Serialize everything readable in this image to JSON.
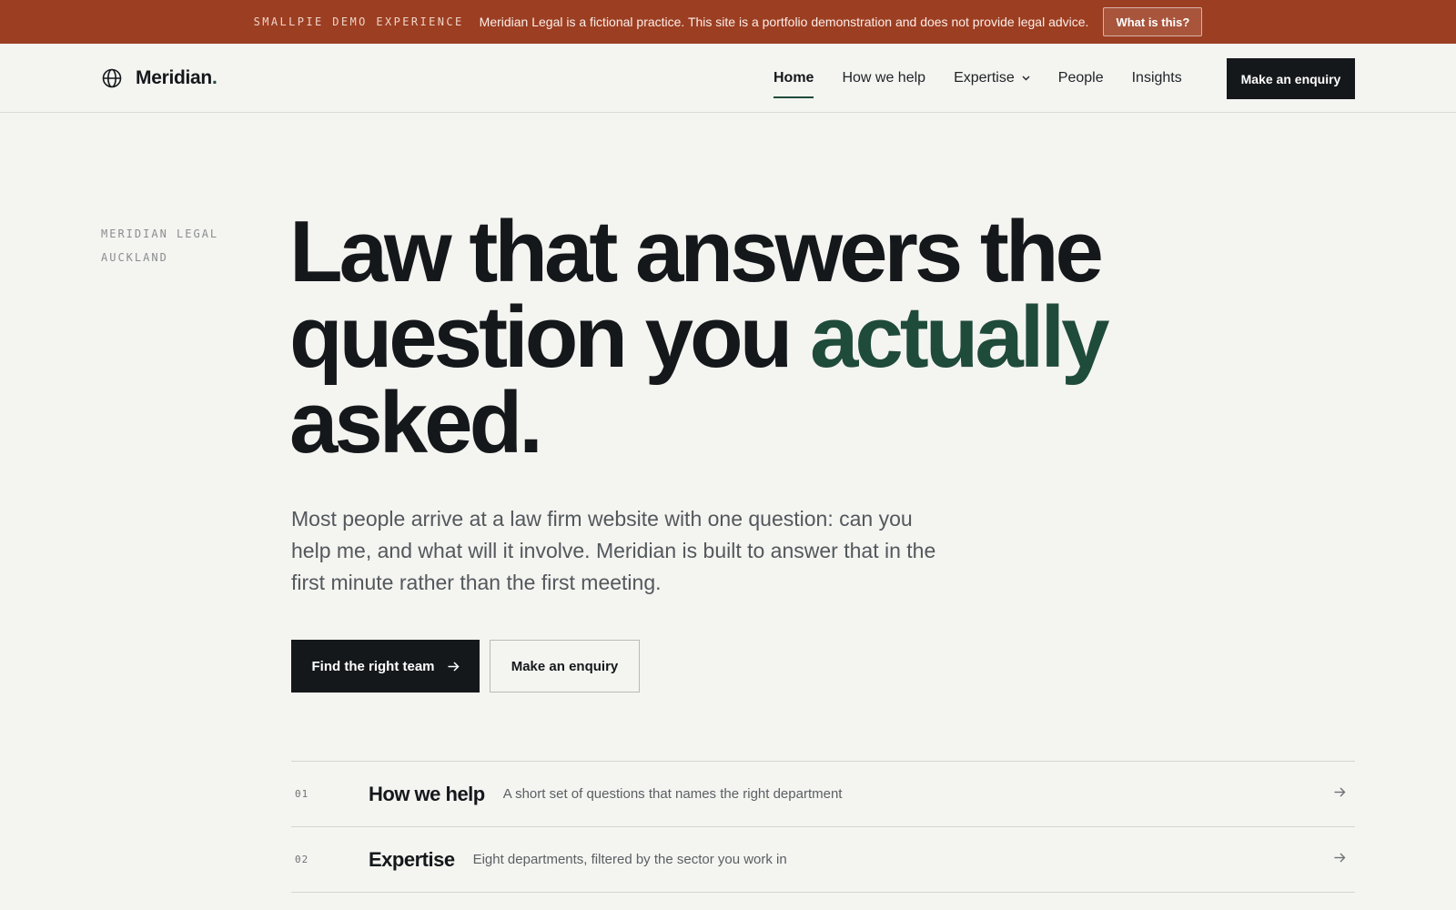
{
  "banner": {
    "tag": "SMALLPIE DEMO EXPERIENCE",
    "text": "Meridian Legal is a fictional practice. This site is a portfolio demonstration and does not provide legal advice.",
    "button": "What is this?"
  },
  "header": {
    "logo_text": "Meridian",
    "logo_dot": ".",
    "logo_icon": "globe-icon",
    "nav": [
      {
        "label": "Home",
        "active": true
      },
      {
        "label": "How we help",
        "active": false
      },
      {
        "label": "Expertise",
        "active": false,
        "has_dropdown": true
      },
      {
        "label": "People",
        "active": false
      },
      {
        "label": "Insights",
        "active": false
      }
    ],
    "cta": "Make an enquiry"
  },
  "hero": {
    "eyebrow_line1": "MERIDIAN LEGAL",
    "eyebrow_line2": "AUCKLAND",
    "headline_part1": "Law that answers the question you ",
    "headline_accent": "actually",
    "headline_part2": " asked.",
    "lede": "Most people arrive at a law firm website with one question: can you help me, and what will it involve. Meridian is built to answer that in the first minute rather than the first meeting.",
    "primary_button": "Find the right team",
    "secondary_button": "Make an enquiry"
  },
  "index": [
    {
      "num": "01",
      "title": "How we help",
      "desc": "A short set of questions that names the right department"
    },
    {
      "num": "02",
      "title": "Expertise",
      "desc": "Eight departments, filtered by the sector you work in"
    }
  ],
  "colors": {
    "banner_bg": "#9c3e22",
    "page_bg": "#f4f4f1",
    "ink": "#15181b",
    "accent_green": "#1f4b3a"
  }
}
